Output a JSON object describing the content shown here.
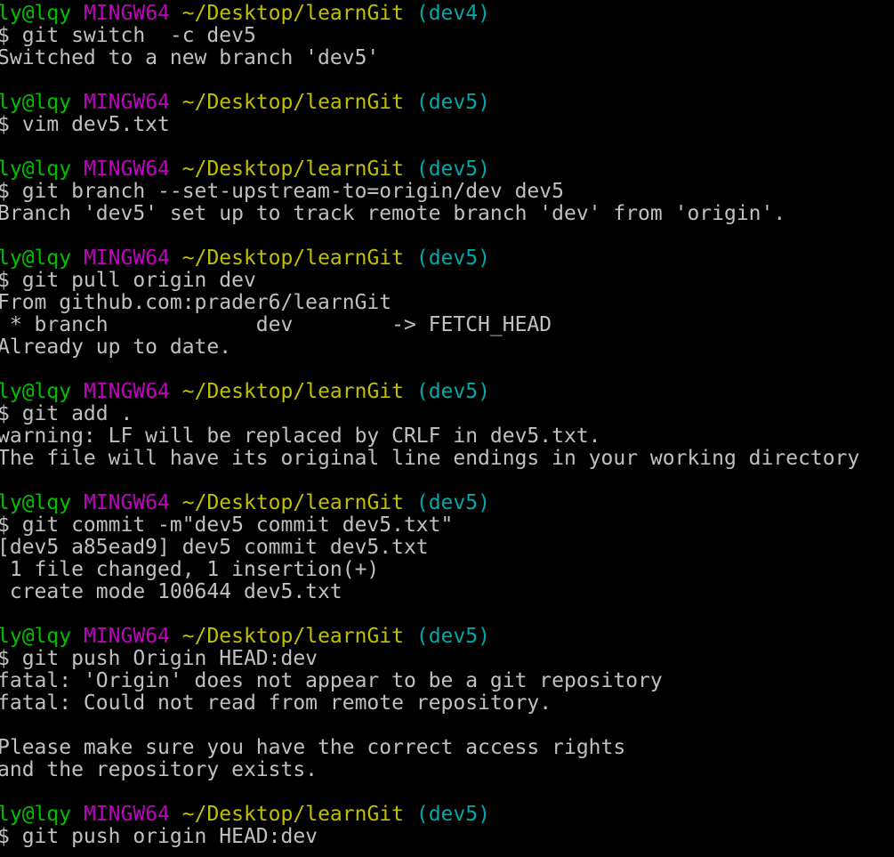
{
  "colors": {
    "background": "#000000",
    "text": "#c0c0c0",
    "user": "#00c000",
    "host": "#c000c0",
    "path": "#c0c000",
    "branch": "#00a8a8"
  },
  "blocks": [
    {
      "prompt": {
        "user": "ly@lqy",
        "host": "MINGW64",
        "path": "~/Desktop/learnGit",
        "branch": "(dev4)"
      },
      "command": "$ git switch  -c dev5",
      "output": [
        "Switched to a new branch 'dev5'"
      ]
    },
    {
      "prompt": {
        "user": "ly@lqy",
        "host": "MINGW64",
        "path": "~/Desktop/learnGit",
        "branch": "(dev5)"
      },
      "command": "$ vim dev5.txt",
      "output": []
    },
    {
      "prompt": {
        "user": "ly@lqy",
        "host": "MINGW64",
        "path": "~/Desktop/learnGit",
        "branch": "(dev5)"
      },
      "command": "$ git branch --set-upstream-to=origin/dev dev5",
      "output": [
        "Branch 'dev5' set up to track remote branch 'dev' from 'origin'."
      ]
    },
    {
      "prompt": {
        "user": "ly@lqy",
        "host": "MINGW64",
        "path": "~/Desktop/learnGit",
        "branch": "(dev5)"
      },
      "command": "$ git pull origin dev",
      "output": [
        "From github.com:prader6/learnGit",
        " * branch            dev        -> FETCH_HEAD",
        "Already up to date."
      ]
    },
    {
      "prompt": {
        "user": "ly@lqy",
        "host": "MINGW64",
        "path": "~/Desktop/learnGit",
        "branch": "(dev5)"
      },
      "command": "$ git add .",
      "output": [
        "warning: LF will be replaced by CRLF in dev5.txt.",
        "The file will have its original line endings in your working directory"
      ]
    },
    {
      "prompt": {
        "user": "ly@lqy",
        "host": "MINGW64",
        "path": "~/Desktop/learnGit",
        "branch": "(dev5)"
      },
      "command": "$ git commit -m\"dev5 commit dev5.txt\"",
      "output": [
        "[dev5 a85ead9] dev5 commit dev5.txt",
        " 1 file changed, 1 insertion(+)",
        " create mode 100644 dev5.txt"
      ]
    },
    {
      "prompt": {
        "user": "ly@lqy",
        "host": "MINGW64",
        "path": "~/Desktop/learnGit",
        "branch": "(dev5)"
      },
      "command": "$ git push Origin HEAD:dev",
      "output": [
        "fatal: 'Origin' does not appear to be a git repository",
        "fatal: Could not read from remote repository.",
        "",
        "Please make sure you have the correct access rights",
        "and the repository exists."
      ]
    },
    {
      "prompt": {
        "user": "ly@lqy",
        "host": "MINGW64",
        "path": "~/Desktop/learnGit",
        "branch": "(dev5)"
      },
      "command": "$ git push origin HEAD:dev",
      "output": []
    }
  ]
}
